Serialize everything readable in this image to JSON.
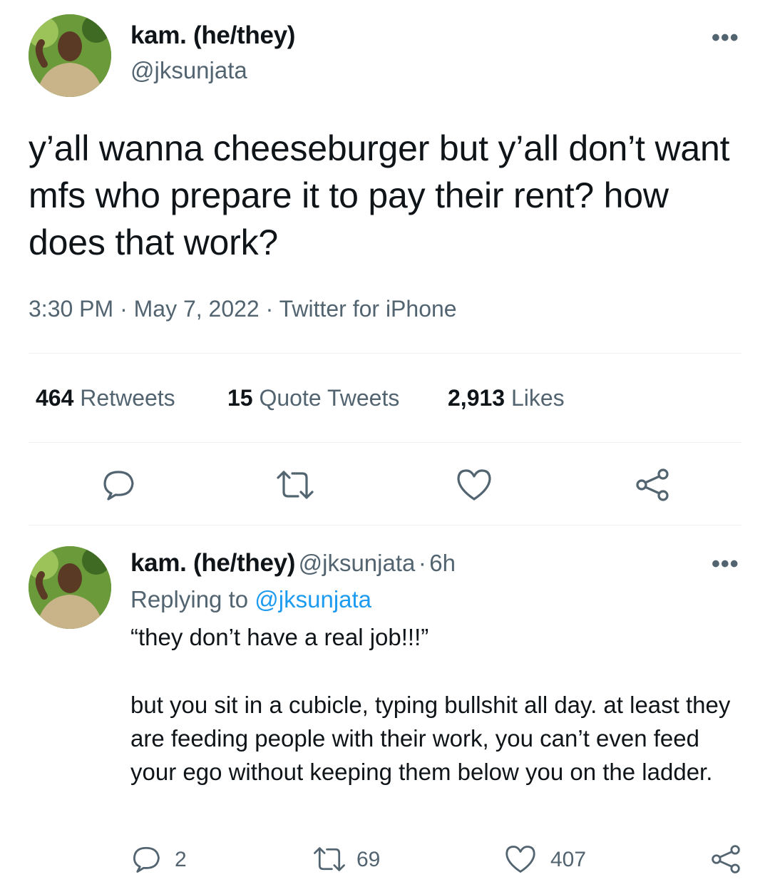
{
  "main_tweet": {
    "author_name": "kam. (he/they)",
    "author_handle": "@jksunjata",
    "text": "y’all wanna cheeseburger but y’all don’t want mfs who prepare it to pay their rent? how does that work?",
    "time": "3:30 PM",
    "date": "May 7, 2022",
    "source": "Twitter for iPhone",
    "sep": "·",
    "retweets_count": "464",
    "retweets_label": "Retweets",
    "quotes_count": "15",
    "quotes_label": "Quote Tweets",
    "likes_count": "2,913",
    "likes_label": "Likes",
    "more": "•••"
  },
  "reply": {
    "author_name": "kam. (he/they)",
    "author_handle": "@jksunjata",
    "sep": "·",
    "age": "6h",
    "replying_prefix": "Replying to",
    "replying_handle": "@jksunjata",
    "line1": "“they don’t have a real job!!!”",
    "line2": "but you sit in a cubicle, typing bullshit all day. at least they are feeding people with their work, you can’t even feed your ego without keeping them below you on the ladder.",
    "reply_count": "2",
    "retweet_count": "69",
    "like_count": "407",
    "more": "•••"
  },
  "icons": [
    "reply-icon",
    "retweet-icon",
    "like-icon",
    "share-icon",
    "more-icon"
  ],
  "colors": {
    "text": "#0f1419",
    "muted": "#536471",
    "link": "#1d9bf0",
    "divider": "#eff3f4"
  }
}
